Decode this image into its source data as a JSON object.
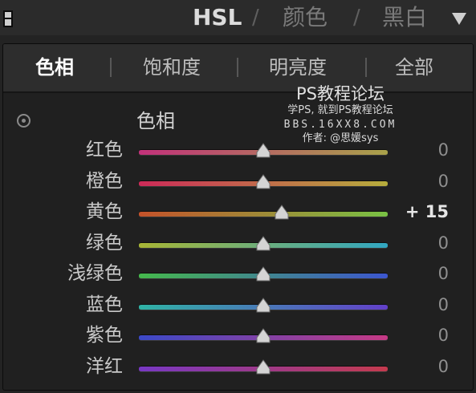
{
  "header": {
    "hsl_label": "HSL",
    "separator": "/",
    "color_label": "颜色",
    "bw_label": "黑白"
  },
  "tabs": [
    {
      "label": "色相",
      "active": true
    },
    {
      "label": "饱和度",
      "active": false
    },
    {
      "label": "明亮度",
      "active": false
    },
    {
      "label": "全部",
      "active": false
    }
  ],
  "section": {
    "title": "色相"
  },
  "watermark": {
    "title": "PS教程论坛",
    "line2": "学PS, 就到PS教程论坛",
    "line3": "BBS.16XX8.COM",
    "line4": "作者: @思媛sys"
  },
  "sliders": [
    {
      "label": "红色",
      "value": 0,
      "value_text": "0",
      "gradient": [
        "#c2317a",
        "#a9a24a"
      ]
    },
    {
      "label": "橙色",
      "value": 0,
      "value_text": "0",
      "gradient": [
        "#cc2a58",
        "#b6ad3c"
      ]
    },
    {
      "label": "黄色",
      "value": 15,
      "value_text": "+ 15",
      "gradient": [
        "#c4522a",
        "#79c244"
      ]
    },
    {
      "label": "绿色",
      "value": 0,
      "value_text": "0",
      "gradient": [
        "#a7b535",
        "#31a7c2"
      ]
    },
    {
      "label": "浅绿色",
      "value": 0,
      "value_text": "0",
      "gradient": [
        "#45b84c",
        "#3c56cf"
      ]
    },
    {
      "label": "蓝色",
      "value": 0,
      "value_text": "0",
      "gradient": [
        "#2fb3a5",
        "#6240c9"
      ]
    },
    {
      "label": "紫色",
      "value": 0,
      "value_text": "0",
      "gradient": [
        "#3b49c8",
        "#c63a85"
      ]
    },
    {
      "label": "洋红",
      "value": 0,
      "value_text": "0",
      "gradient": [
        "#7838c4",
        "#c43a4e"
      ]
    }
  ],
  "slider_range": [
    -100,
    100
  ]
}
